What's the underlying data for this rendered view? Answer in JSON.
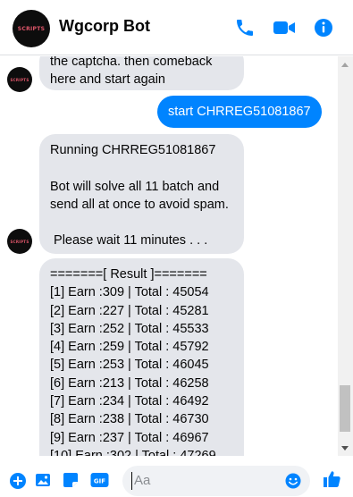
{
  "header": {
    "title": "Wgcorp Bot",
    "avatar_text": "SCRIPTS"
  },
  "messages": [
    {
      "from": "bot",
      "text": "the captcha. then comeback\nhere and start again"
    },
    {
      "from": "user",
      "text": "start CHRREG51081867"
    },
    {
      "from": "bot",
      "text": "Running CHRREG51081867\n\nBot will solve all 11 batch and\nsend all at once to avoid spam.\n\n Please wait 11 minutes . . ."
    },
    {
      "from": "bot",
      "text": "=======[ Result ]=======\n[1] Earn :309 | Total : 45054\n[2] Earn :227 | Total : 45281\n[3] Earn :252 | Total : 45533\n[4] Earn :259 | Total : 45792\n[5] Earn :253 | Total : 46045\n[6] Earn :213 | Total : 46258\n[7] Earn :234 | Total : 46492\n[8] Earn :238 | Total : 46730\n[9] Earn :237 | Total : 46967\n[10] Earn :302 | Total : 47269"
    }
  ],
  "composer": {
    "placeholder": "Aa"
  },
  "colors": {
    "accent": "#0084ff",
    "bubble_in": "#e4e6eb",
    "avatar_bg": "#0d0d0d"
  },
  "icons": [
    "phone-icon",
    "video-icon",
    "info-icon",
    "plus-icon",
    "image-icon",
    "sticker-icon",
    "gif-icon",
    "emoji-icon",
    "like-icon"
  ]
}
